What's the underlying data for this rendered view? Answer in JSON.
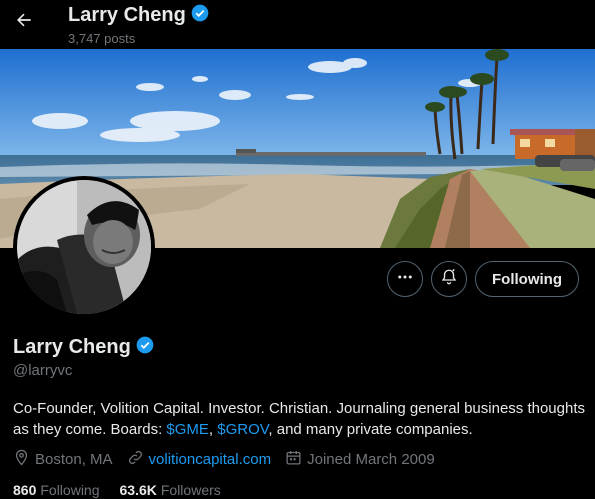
{
  "header": {
    "display_name": "Larry Cheng",
    "post_count": "3,747 posts"
  },
  "profile": {
    "display_name": "Larry Cheng",
    "handle": "@larryvc",
    "bio": {
      "part1": "Co-Founder, Volition Capital. Investor. Christian. Journaling general business thoughts as they come. Boards: ",
      "link1": "$GME",
      "sep": ", ",
      "link2": "$GROV",
      "part2": ", and many private companies."
    },
    "location": "Boston, MA",
    "website": "volitioncapital.com",
    "joined": "Joined March 2009",
    "following_count": "860",
    "following_label": "Following",
    "followers_count": "63.6K",
    "followers_label": "Followers"
  },
  "actions": {
    "follow_label": "Following"
  },
  "colors": {
    "accent": "#1d9bf0",
    "secondary_text": "#71767b",
    "border": "#536471"
  },
  "icons": [
    "back-arrow-icon",
    "verified-badge-icon",
    "more-icon",
    "notification-bell-icon",
    "location-pin-icon",
    "link-icon",
    "calendar-icon"
  ]
}
